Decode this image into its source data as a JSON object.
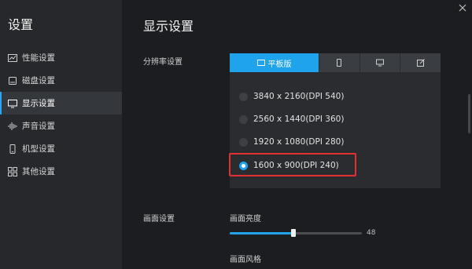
{
  "sidebar": {
    "title": "设置",
    "items": [
      {
        "label": "性能设置",
        "icon": "chart-icon"
      },
      {
        "label": "磁盘设置",
        "icon": "disk-icon"
      },
      {
        "label": "显示设置",
        "icon": "monitor-icon"
      },
      {
        "label": "声音设置",
        "icon": "sound-icon"
      },
      {
        "label": "机型设置",
        "icon": "phone-icon"
      },
      {
        "label": "其他设置",
        "icon": "grid-icon"
      }
    ],
    "active_index": 2
  },
  "main": {
    "title": "显示设置",
    "resolution": {
      "label": "分辨率设置",
      "tabs": [
        {
          "label": "平板版",
          "icon": "tablet-icon"
        },
        {
          "label": "",
          "icon": "phone-icon"
        },
        {
          "label": "",
          "icon": "monitor-icon"
        },
        {
          "label": "",
          "icon": "edit-icon"
        }
      ],
      "active_tab": 0,
      "options": [
        "3840 x 2160(DPI 540)",
        "2560 x 1440(DPI 360)",
        "1920 x 1080(DPI 280)",
        "1600 x 900(DPI 240)"
      ],
      "selected_index": 3
    },
    "picture": {
      "label": "画面设置",
      "brightness_label": "画面亮度",
      "brightness_value": "48",
      "brightness_fraction": 0.48,
      "style_label": "画面风格"
    }
  },
  "colors": {
    "accent": "#1fa3ea",
    "highlight": "#e03030"
  }
}
